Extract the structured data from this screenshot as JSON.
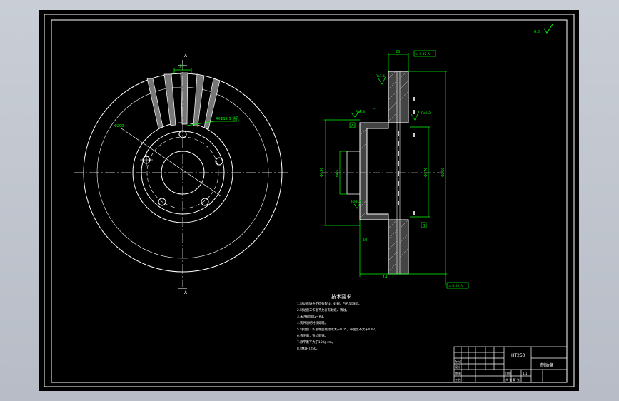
{
  "colors": {
    "background": "#000000",
    "frame": "#ffffff",
    "dimension": "#00ff00",
    "screen_edge": "#b9bec7"
  },
  "surface_finish_corner": "6.3",
  "front_view": {
    "section_mark_top": "A",
    "section_mark_bottom": "A",
    "angle_label": "9°",
    "hole_callout": "4XΦ12.5 通孔",
    "circle_dia": "Φ200"
  },
  "section_view": {
    "dim_top": "25",
    "flatness_top": "⊥ 0.02 A",
    "roughness_labels": [
      "Ra1.6",
      "Ra3.2",
      "Ra6.3",
      "Ra3.2"
    ],
    "dims_left": [
      "Φ130",
      "Φ65"
    ],
    "dims_right": [
      "Φ170",
      "Φ250"
    ],
    "datum_left": "A",
    "datum_right": "B",
    "dim_hub": "50",
    "dim_bottom": "14",
    "perp_bottom": "⊥ 0.02 A",
    "chamfer_label": "C1",
    "angle_r": "R3"
  },
  "technical_requirements": {
    "title": "技术要求",
    "lines": [
      "1.制动盘铸件不得有裂纹、砂眼、气孔等缺陷。",
      "2.制动盘工作面不允许有划痕、锈蚀。",
      "3.未注圆角R2~R3。",
      "4.铸件须经时效处理。",
      "5.制动盘工作面端面跳动不大于0.05，平面度不大于0.02。",
      "6.去毛刺，锐边倒钝。",
      "7.静平衡不大于150g·cm。",
      "8.材料HT250。"
    ]
  },
  "title_block": {
    "material": "HT250",
    "part_name": "制动盘",
    "row_labels": [
      "标记",
      "设计",
      "审核",
      "工艺"
    ],
    "scale_label": "比例",
    "scale": "1:1",
    "sheet": "共 张 第 张"
  }
}
